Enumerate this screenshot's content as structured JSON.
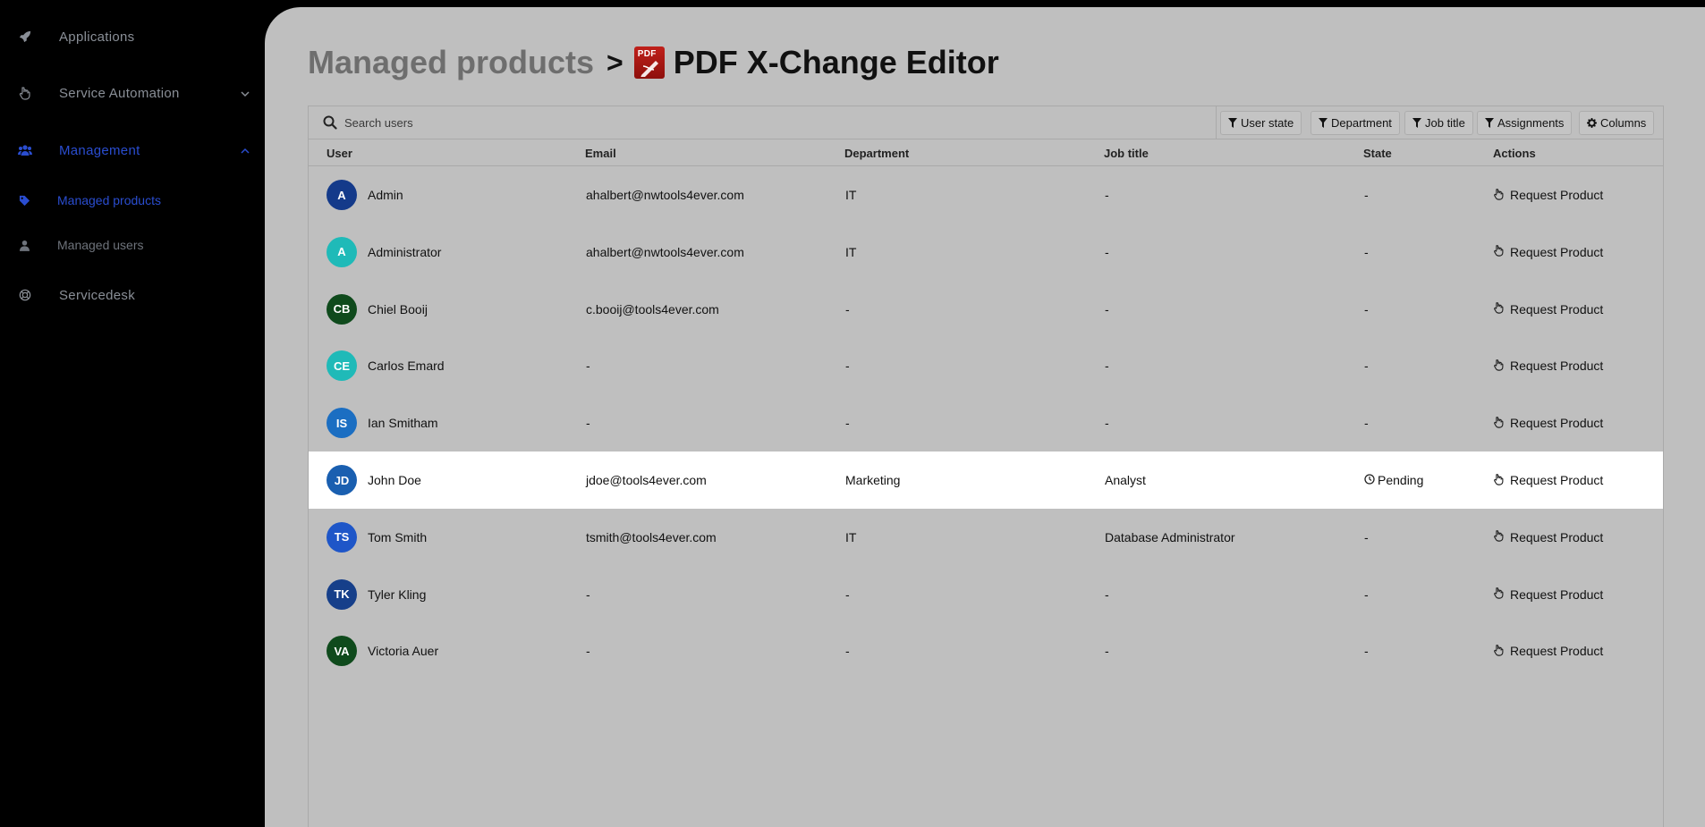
{
  "sidebar": {
    "items": [
      {
        "label": "Applications",
        "icon": "rocket-icon"
      },
      {
        "label": "Service Automation",
        "icon": "hand-pointer-icon"
      },
      {
        "label": "Management",
        "icon": "users-icon"
      },
      {
        "label": "Servicedesk",
        "icon": "lifebuoy-icon"
      }
    ],
    "sub_items": [
      {
        "label": "Managed products",
        "icon": "tag-icon"
      },
      {
        "label": "Managed users",
        "icon": "user-icon"
      }
    ]
  },
  "header": {
    "breadcrumb": "Managed products",
    "separator": ">",
    "current": "PDF X-Change Editor",
    "logo_text": "PDF"
  },
  "toolbar": {
    "search_placeholder": "Search users",
    "filters": [
      "User state",
      "Department",
      "Job title",
      "Assignments"
    ],
    "columns_label": "Columns"
  },
  "table": {
    "columns": [
      "User",
      "Email",
      "Department",
      "Job title",
      "State",
      "Actions"
    ],
    "rows": [
      {
        "initials": "A",
        "name": "Admin",
        "email": "ahalbert@nwtools4ever.com",
        "department": "IT",
        "job_title": "-",
        "state": "-",
        "action": "Request Product",
        "avatar_color": "#143a8a"
      },
      {
        "initials": "A",
        "name": "Administrator",
        "email": "ahalbert@nwtools4ever.com",
        "department": "IT",
        "job_title": "-",
        "state": "-",
        "action": "Request Product",
        "avatar_color": "#1fbab8"
      },
      {
        "initials": "CB",
        "name": "Chiel Booij",
        "email": "c.booij@tools4ever.com",
        "department": "-",
        "job_title": "-",
        "state": "-",
        "action": "Request Product",
        "avatar_color": "#0f4a1c"
      },
      {
        "initials": "CE",
        "name": "Carlos Emard",
        "email": "-",
        "department": "-",
        "job_title": "-",
        "state": "-",
        "action": "Request Product",
        "avatar_color": "#1fbab8"
      },
      {
        "initials": "IS",
        "name": "Ian Smitham",
        "email": "-",
        "department": "-",
        "job_title": "-",
        "state": "-",
        "action": "Request Product",
        "avatar_color": "#1b6ec2"
      },
      {
        "initials": "JD",
        "name": "John Doe",
        "email": "jdoe@tools4ever.com",
        "department": "Marketing",
        "job_title": "Analyst",
        "state": "Pending",
        "action": "Request Product",
        "avatar_color": "#1a5fb0"
      },
      {
        "initials": "TS",
        "name": "Tom Smith",
        "email": "tsmith@tools4ever.com",
        "department": "IT",
        "job_title": "Database Administrator",
        "state": "-",
        "action": "Request Product",
        "avatar_color": "#1e56c8"
      },
      {
        "initials": "TK",
        "name": "Tyler Kling",
        "email": "-",
        "department": "-",
        "job_title": "-",
        "state": "-",
        "action": "Request Product",
        "avatar_color": "#163f8a"
      },
      {
        "initials": "VA",
        "name": "Victoria Auer",
        "email": "-",
        "department": "-",
        "job_title": "-",
        "state": "-",
        "action": "Request Product",
        "avatar_color": "#0f4a1c"
      }
    ],
    "highlighted_row": "John Doe"
  },
  "colors": {
    "active_nav": "#2a4dd0",
    "main_bg": "#bfbfbf",
    "sidebar_bg": "#000000"
  }
}
